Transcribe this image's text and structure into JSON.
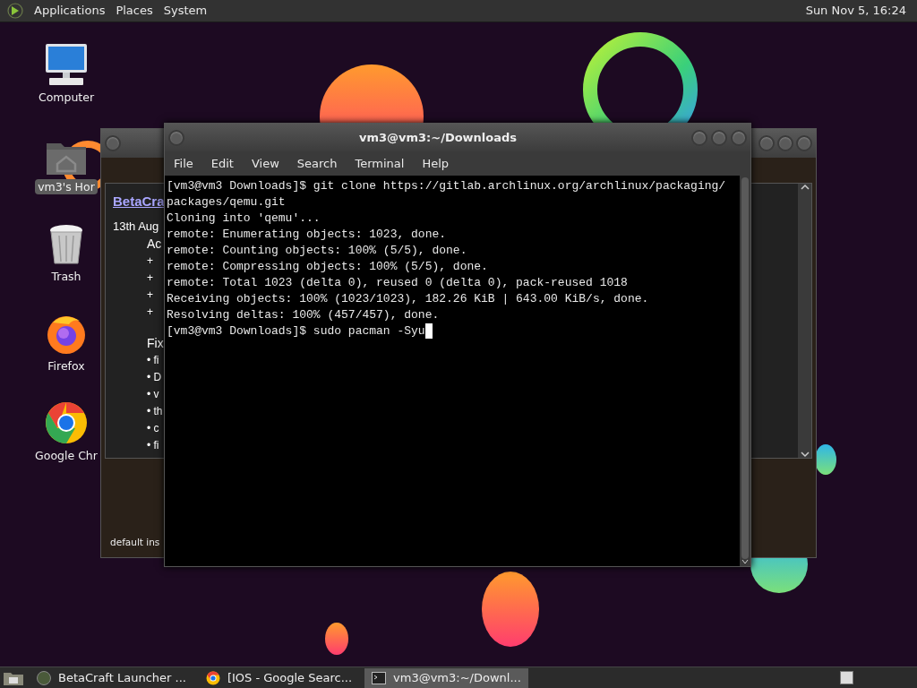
{
  "top_panel": {
    "menus": [
      "Applications",
      "Places",
      "System"
    ],
    "clock": "Sun Nov 5, 16:24"
  },
  "desktop_icons": [
    {
      "label": "Computer",
      "kind": "computer",
      "selected": false
    },
    {
      "label": "vm3's Hor",
      "kind": "home",
      "selected": true
    },
    {
      "label": "Trash",
      "kind": "trash",
      "selected": false
    },
    {
      "label": "Firefox",
      "kind": "firefox",
      "selected": false
    },
    {
      "label": "Google Chr",
      "kind": "chrome",
      "selected": false
    }
  ],
  "back_window": {
    "link": "BetaCra",
    "date": "13th Aug",
    "lines": [
      {
        "text": "Ac",
        "kind": "heading"
      },
      {
        "text": "+",
        "kind": "item"
      },
      {
        "text": "+",
        "kind": "item"
      },
      {
        "text": "+",
        "kind": "item"
      },
      {
        "text": "+",
        "kind": "item"
      },
      {
        "text": "Fix",
        "kind": "heading"
      },
      {
        "text": "• fi",
        "kind": "item"
      },
      {
        "text": "• D",
        "kind": "item"
      },
      {
        "text": "• v",
        "kind": "item"
      },
      {
        "text": "• th",
        "kind": "item"
      },
      {
        "text": "• c",
        "kind": "item"
      },
      {
        "text": "• fi",
        "kind": "item"
      }
    ],
    "footer": "default ins"
  },
  "terminal": {
    "title": "vm3@vm3:~/Downloads",
    "menu": [
      "File",
      "Edit",
      "View",
      "Search",
      "Terminal",
      "Help"
    ],
    "lines": [
      "[vm3@vm3 Downloads]$ git clone https://gitlab.archlinux.org/archlinux/packaging/",
      "packages/qemu.git",
      "Cloning into 'qemu'...",
      "remote: Enumerating objects: 1023, done.",
      "remote: Counting objects: 100% (5/5), done.",
      "remote: Compressing objects: 100% (5/5), done.",
      "remote: Total 1023 (delta 0), reused 0 (delta 0), pack-reused 1018",
      "Receiving objects: 100% (1023/1023), 182.26 KiB | 643.00 KiB/s, done.",
      "Resolving deltas: 100% (457/457), done.",
      "[vm3@vm3 Downloads]$ sudo pacman -Syu"
    ]
  },
  "taskbar": {
    "items": [
      {
        "label": "BetaCraft Launcher ...",
        "kind": "app",
        "selected": false
      },
      {
        "label": "[IOS - Google Searc...",
        "kind": "browser",
        "selected": false
      },
      {
        "label": "vm3@vm3:~/Downl...",
        "kind": "terminal",
        "selected": true
      }
    ]
  }
}
